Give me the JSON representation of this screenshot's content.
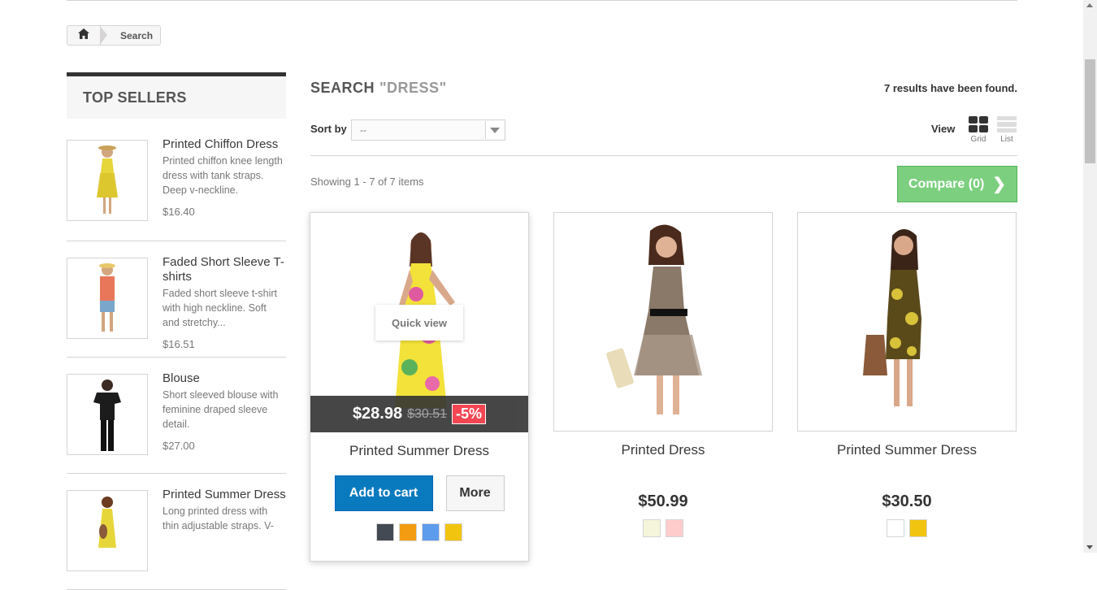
{
  "breadcrumb": {
    "home_icon": "home-icon",
    "current": "Search"
  },
  "sidebar": {
    "title": "TOP SELLERS",
    "items": [
      {
        "name": "Printed Chiffon Dress",
        "desc": "Printed chiffon knee length dress with tank straps. Deep v-neckline.",
        "price": "$16.40"
      },
      {
        "name": "Faded Short Sleeve T-shirts",
        "desc": "Faded short sleeve t-shirt with high neckline. Soft and stretchy...",
        "price": "$16.51"
      },
      {
        "name": "Blouse",
        "desc": "Short sleeved blouse with feminine draped sleeve detail.",
        "price": "$27.00"
      },
      {
        "name": "Printed Summer Dress",
        "desc": "Long printed dress with thin adjustable straps. V-",
        "price": ""
      }
    ]
  },
  "search": {
    "label": "SEARCH",
    "query": "\"DRESS\"",
    "results": "7 results have been found."
  },
  "sort": {
    "label": "Sort by",
    "value": "--"
  },
  "view": {
    "label": "View",
    "grid": "Grid",
    "list": "List"
  },
  "showing": "Showing 1 - 7 of 7 items",
  "compare": {
    "label": "Compare (0)",
    "icon": "chevron-right-icon"
  },
  "products": [
    {
      "name": "Printed Summer Dress",
      "price": "$28.98",
      "old_price": "$30.51",
      "discount": "-5%",
      "quick_view": "Quick view",
      "add_to_cart": "Add to cart",
      "more": "More",
      "colors": [
        "#434a54",
        "#f39c11",
        "#5d9cec",
        "#f1c40f"
      ]
    },
    {
      "name": "Printed Dress",
      "price": "$50.99",
      "colors": [
        "#f5f5dc",
        "#fcc"
      ]
    },
    {
      "name": "Printed Summer Dress",
      "price": "$30.50",
      "colors": [
        "#ffffff",
        "#f1c40f"
      ]
    }
  ]
}
